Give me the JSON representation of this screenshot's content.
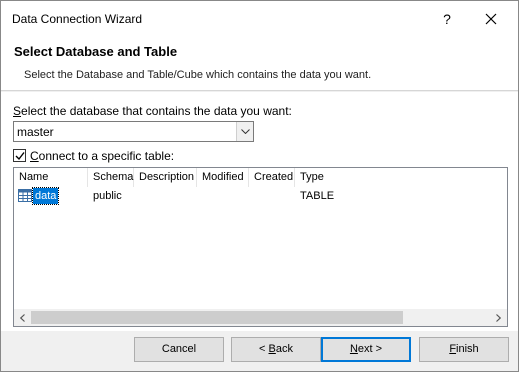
{
  "window": {
    "title": "Data Connection Wizard",
    "help_label": "?"
  },
  "header": {
    "title": "Select Database and Table",
    "subtitle": "Select the Database and Table/Cube which contains the data you want."
  },
  "database": {
    "label_accel": "S",
    "label_rest": "elect the database that contains the data you want:",
    "selected": "master"
  },
  "connect_table": {
    "checked": true,
    "label_accel": "C",
    "label_rest": "onnect to a specific table:"
  },
  "table_list": {
    "columns": [
      "Name",
      "Schema",
      "Description",
      "Modified",
      "Created",
      "Type"
    ],
    "rows": [
      {
        "name": "data",
        "schema": "public",
        "description": "",
        "modified": "",
        "created": "",
        "type": "TABLE",
        "selected": true
      }
    ]
  },
  "buttons": {
    "cancel": "Cancel",
    "back_prefix": "< ",
    "back_accel": "B",
    "back_rest": "ack",
    "next_accel": "N",
    "next_rest": "ext >",
    "finish_accel": "F",
    "finish_rest": "inish"
  },
  "colors": {
    "accent": "#0078d7",
    "dialog_bg": "#f0f0f0",
    "button_bg": "#e1e1e1"
  },
  "icons": {
    "help": "help-icon",
    "close": "close-icon",
    "dropdown": "chevron-down-icon",
    "check": "checkmark-icon",
    "table": "table-icon",
    "scroll_left": "chevron-left-icon",
    "scroll_right": "chevron-right-icon"
  }
}
